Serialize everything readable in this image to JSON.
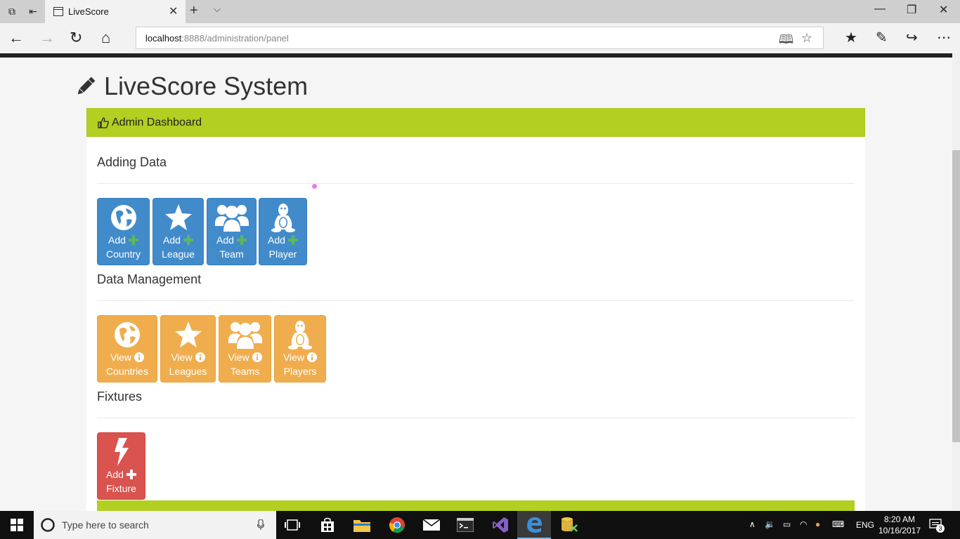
{
  "browser": {
    "tab_title": "LiveScore",
    "address_host": "localhost",
    "address_path": ":8888/administration/panel"
  },
  "page": {
    "title": "LiveScore System",
    "panel_heading": "Admin Dashboard",
    "sections": {
      "adding": "Adding Data",
      "management": "Data Management",
      "fixtures": "Fixtures"
    },
    "adding_tiles": [
      {
        "verb": "Add",
        "noun": "Country",
        "icon": "globe-icon"
      },
      {
        "verb": "Add",
        "noun": "League",
        "icon": "star-icon"
      },
      {
        "verb": "Add",
        "noun": "Team",
        "icon": "users-icon"
      },
      {
        "verb": "Add",
        "noun": "Player",
        "icon": "linux-icon"
      }
    ],
    "management_tiles": [
      {
        "verb": "View",
        "noun": "Countries",
        "icon": "globe-icon"
      },
      {
        "verb": "View",
        "noun": "Leagues",
        "icon": "star-icon"
      },
      {
        "verb": "View",
        "noun": "Teams",
        "icon": "users-icon"
      },
      {
        "verb": "View",
        "noun": "Players",
        "icon": "linux-icon"
      }
    ],
    "fixture_tiles": [
      {
        "verb": "Add",
        "noun": "Fixture",
        "icon": "bolt-icon"
      }
    ]
  },
  "taskbar": {
    "search_placeholder": "Type here to search",
    "language": "ENG",
    "time": "8:20 AM",
    "date": "10/16/2017",
    "notifications": "3"
  },
  "colors": {
    "panel_heading": "#b2cf22",
    "primary": "#428bca",
    "warning": "#f0ad4e",
    "danger": "#d9534f",
    "plus_green": "#5cb85c"
  }
}
